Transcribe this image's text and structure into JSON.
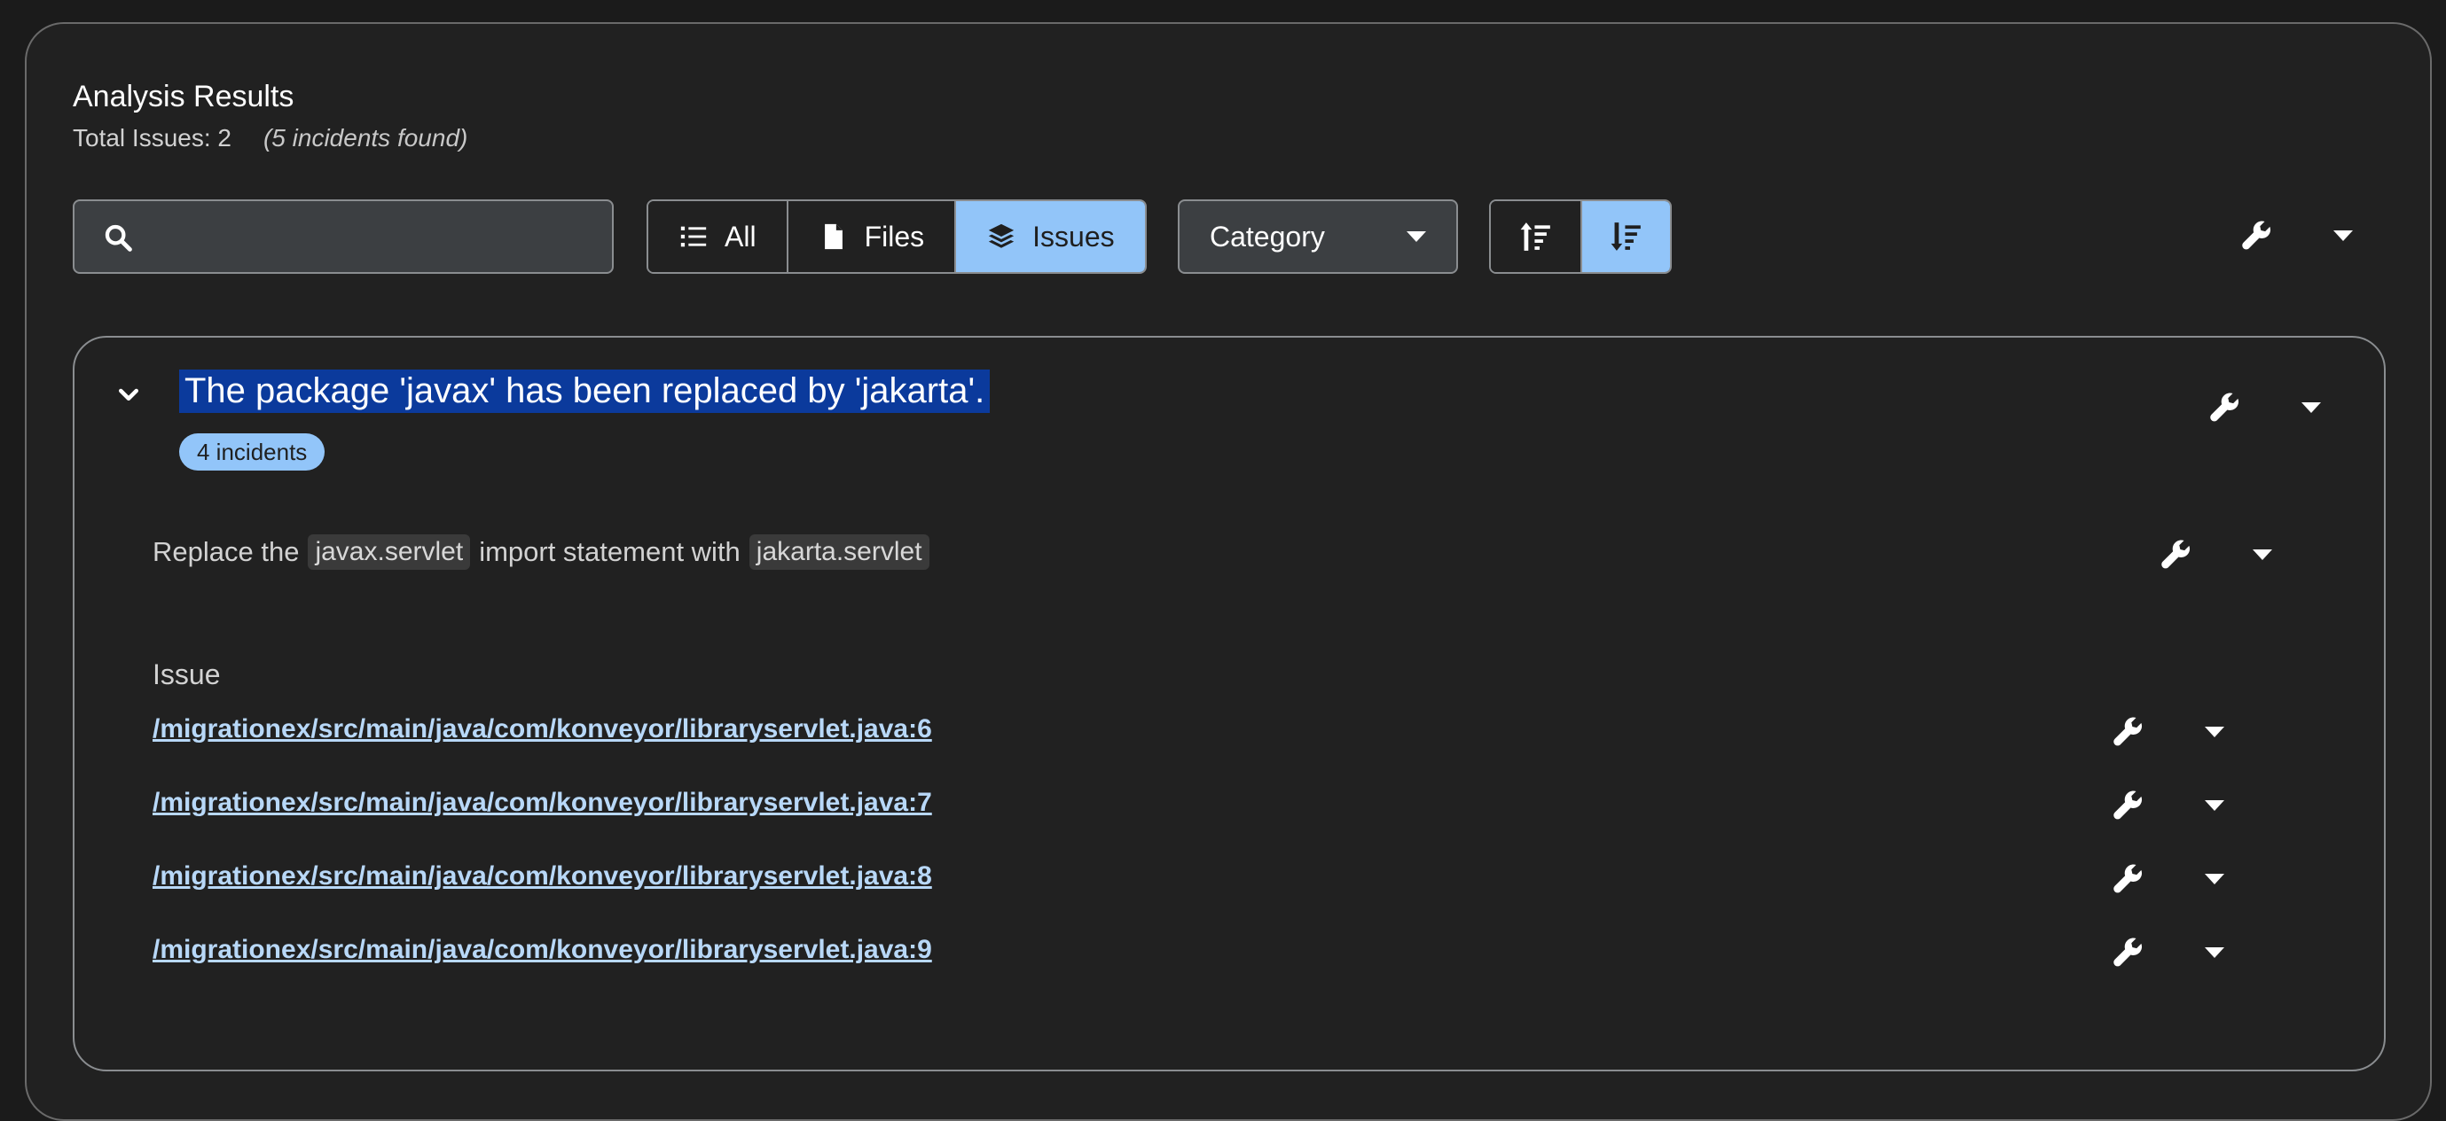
{
  "header": {
    "title": "Analysis Results",
    "total_issues_label": "Total Issues: 2",
    "incidents_found": "(5 incidents found)"
  },
  "toolbar": {
    "search": {
      "value": "",
      "placeholder": "",
      "icon": "search-icon"
    },
    "view_toggle": [
      {
        "label": "All",
        "icon": "list-icon",
        "selected": false
      },
      {
        "label": "Files",
        "icon": "file-icon",
        "selected": false
      },
      {
        "label": "Issues",
        "icon": "layers-icon",
        "selected": true
      }
    ],
    "group_by": {
      "value": "Category",
      "icon": "caret-down-icon"
    },
    "sort": [
      {
        "icon": "sort-ascending-icon",
        "selected": false
      },
      {
        "icon": "sort-descending-icon",
        "selected": true
      }
    ],
    "actions": {
      "icon": "wrench-icon",
      "menu_icon": "caret-down-icon"
    }
  },
  "issue": {
    "title": "The package 'javax' has been replaced by 'jakarta'.",
    "incident_count": "4 incidents",
    "hint": {
      "prefix": "Replace the",
      "code_from": "javax.servlet",
      "middle": "import statement with",
      "code_to": "jakarta.servlet"
    },
    "list_header": "Issue",
    "incidents": [
      "/migrationex/src/main/java/com/konveyor/libraryservlet.java:6",
      "/migrationex/src/main/java/com/konveyor/libraryservlet.java:7",
      "/migrationex/src/main/java/com/konveyor/libraryservlet.java:8",
      "/migrationex/src/main/java/com/konveyor/libraryservlet.java:9"
    ]
  },
  "colors": {
    "accent": "#92c5f9",
    "selection": "#0b3a9c",
    "link": "#b8d8f8",
    "background": "#212121"
  }
}
